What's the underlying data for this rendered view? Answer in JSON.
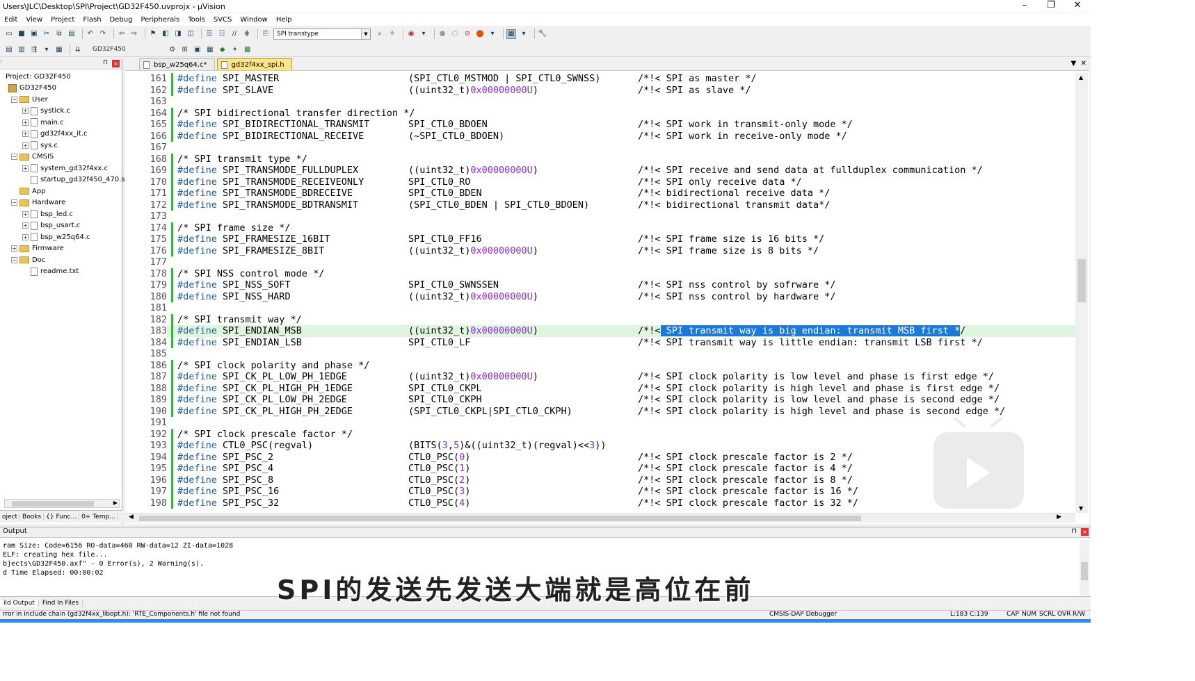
{
  "window": {
    "title": "Users\\JLC\\Desktop\\SPI\\Project\\GD32F450.uvprojx - µVision"
  },
  "menu": [
    "Edit",
    "View",
    "Project",
    "Flash",
    "Debug",
    "Peripherals",
    "Tools",
    "SVCS",
    "Window",
    "Help"
  ],
  "toolbar": {
    "find_combo": "SPI transtype",
    "target": "GD32F450"
  },
  "project": {
    "header": ":",
    "items": [
      {
        "label": "Project: GD32F450",
        "level": 0,
        "kind": "root"
      },
      {
        "label": "GD32F450",
        "level": 1,
        "kind": "project"
      },
      {
        "label": "User",
        "level": 2,
        "kind": "folder"
      },
      {
        "label": "systick.c",
        "level": 3,
        "kind": "file"
      },
      {
        "label": "main.c",
        "level": 3,
        "kind": "file"
      },
      {
        "label": "gd32f4xx_it.c",
        "level": 3,
        "kind": "file"
      },
      {
        "label": "sys.c",
        "level": 3,
        "kind": "file"
      },
      {
        "label": "CMSIS",
        "level": 2,
        "kind": "folder"
      },
      {
        "label": "system_gd32f4xx.c",
        "level": 3,
        "kind": "file"
      },
      {
        "label": "startup_gd32f450_470.s",
        "level": 3,
        "kind": "file"
      },
      {
        "label": "App",
        "level": 2,
        "kind": "folder"
      },
      {
        "label": "Hardware",
        "level": 2,
        "kind": "folder"
      },
      {
        "label": "bsp_led.c",
        "level": 3,
        "kind": "file"
      },
      {
        "label": "bsp_usart.c",
        "level": 3,
        "kind": "file"
      },
      {
        "label": "bsp_w25q64.c",
        "level": 3,
        "kind": "file"
      },
      {
        "label": "Firmware",
        "level": 2,
        "kind": "folder"
      },
      {
        "label": "Doc",
        "level": 2,
        "kind": "folder"
      },
      {
        "label": "readme.txt",
        "level": 3,
        "kind": "file"
      }
    ],
    "tabs": [
      "oject",
      "Books",
      "{} Func...",
      "0+ Temp..."
    ]
  },
  "editor": {
    "tabs": [
      {
        "label": "bsp_w25q64.c*",
        "active": false
      },
      {
        "label": "gd32f4xx_spi.h",
        "active": true
      }
    ],
    "current_line": 183,
    "lines": [
      {
        "n": "161",
        "a": "#define SPI_MASTER",
        "b": "(SPI_CTL0_MSTMOD | SPI_CTL0_SWNSS)",
        "c": "/*!< SPI as master */"
      },
      {
        "n": "162",
        "a": "#define SPI_SLAVE",
        "b": "((uint32_t)0x00000000U)",
        "c": "/*!< SPI as slave */"
      },
      {
        "n": "163",
        "a": "",
        "b": "",
        "c": ""
      },
      {
        "n": "164",
        "a": "/* SPI bidirectional transfer direction */",
        "b": "",
        "c": ""
      },
      {
        "n": "165",
        "a": "#define SPI_BIDIRECTIONAL_TRANSMIT",
        "b": "SPI_CTL0_BDOEN",
        "c": "/*!< SPI work in transmit-only mode */"
      },
      {
        "n": "166",
        "a": "#define SPI_BIDIRECTIONAL_RECEIVE",
        "b": "(~SPI_CTL0_BDOEN)",
        "c": "/*!< SPI work in receive-only mode */"
      },
      {
        "n": "167",
        "a": "",
        "b": "",
        "c": ""
      },
      {
        "n": "168",
        "a": "/* SPI transmit type */",
        "b": "",
        "c": ""
      },
      {
        "n": "169",
        "a": "#define SPI_TRANSMODE_FULLDUPLEX",
        "b": "((uint32_t)0x00000000U)",
        "c": "/*!< SPI receive and send data at fullduplex communication */"
      },
      {
        "n": "170",
        "a": "#define SPI_TRANSMODE_RECEIVEONLY",
        "b": "SPI_CTL0_RO",
        "c": "/*!< SPI only receive data */"
      },
      {
        "n": "171",
        "a": "#define SPI_TRANSMODE_BDRECEIVE",
        "b": "SPI_CTL0_BDEN",
        "c": "/*!< bidirectional receive data */"
      },
      {
        "n": "172",
        "a": "#define SPI_TRANSMODE_BDTRANSMIT",
        "b": "(SPI_CTL0_BDEN | SPI_CTL0_BDOEN)",
        "c": "/*!< bidirectional transmit data*/"
      },
      {
        "n": "173",
        "a": "",
        "b": "",
        "c": ""
      },
      {
        "n": "174",
        "a": "/* SPI frame size */",
        "b": "",
        "c": ""
      },
      {
        "n": "175",
        "a": "#define SPI_FRAMESIZE_16BIT",
        "b": "SPI_CTL0_FF16",
        "c": "/*!< SPI frame size is 16 bits */"
      },
      {
        "n": "176",
        "a": "#define SPI_FRAMESIZE_8BIT",
        "b": "((uint32_t)0x00000000U)",
        "c": "/*!< SPI frame size is 8 bits */"
      },
      {
        "n": "177",
        "a": "",
        "b": "",
        "c": ""
      },
      {
        "n": "178",
        "a": "/* SPI NSS control mode */",
        "b": "",
        "c": ""
      },
      {
        "n": "179",
        "a": "#define SPI_NSS_SOFT",
        "b": "SPI_CTL0_SWNSSEN",
        "c": "/*!< SPI nss control by sofrware */"
      },
      {
        "n": "180",
        "a": "#define SPI_NSS_HARD",
        "b": "((uint32_t)0x00000000U)",
        "c": "/*!< SPI nss control by hardware */"
      },
      {
        "n": "181",
        "a": "",
        "b": "",
        "c": ""
      },
      {
        "n": "182",
        "a": "/* SPI transmit way */",
        "b": "",
        "c": ""
      },
      {
        "n": "183",
        "a": "#define SPI_ENDIAN_MSB",
        "b": "((uint32_t)0x00000000U)",
        "c": "/*!< SPI transmit way is big endian: transmit MSB first */"
      },
      {
        "n": "184",
        "a": "#define SPI_ENDIAN_LSB",
        "b": "SPI_CTL0_LF",
        "c": "/*!< SPI transmit way is little endian: transmit LSB first */"
      },
      {
        "n": "185",
        "a": "",
        "b": "",
        "c": ""
      },
      {
        "n": "186",
        "a": "/* SPI clock polarity and phase */",
        "b": "",
        "c": ""
      },
      {
        "n": "187",
        "a": "#define SPI_CK_PL_LOW_PH_1EDGE",
        "b": "((uint32_t)0x00000000U)",
        "c": "/*!< SPI clock polarity is low level and phase is first edge */"
      },
      {
        "n": "188",
        "a": "#define SPI_CK_PL_HIGH_PH_1EDGE",
        "b": "SPI_CTL0_CKPL",
        "c": "/*!< SPI clock polarity is high level and phase is first edge */"
      },
      {
        "n": "189",
        "a": "#define SPI_CK_PL_LOW_PH_2EDGE",
        "b": "SPI_CTL0_CKPH",
        "c": "/*!< SPI clock polarity is low level and phase is second edge */"
      },
      {
        "n": "190",
        "a": "#define SPI_CK_PL_HIGH_PH_2EDGE",
        "b": "(SPI_CTL0_CKPL|SPI_CTL0_CKPH)",
        "c": "/*!< SPI clock polarity is high level and phase is second edge */"
      },
      {
        "n": "191",
        "a": "",
        "b": "",
        "c": ""
      },
      {
        "n": "192",
        "a": "/* SPI clock prescale factor */",
        "b": "",
        "c": ""
      },
      {
        "n": "193",
        "a": "#define CTL0_PSC(regval)",
        "b": "(BITS(3,5)&((uint32_t)(regval)<<3))",
        "c": ""
      },
      {
        "n": "194",
        "a": "#define SPI_PSC_2",
        "b": "CTL0_PSC(0)",
        "c": "/*!< SPI clock prescale factor is 2 */"
      },
      {
        "n": "195",
        "a": "#define SPI_PSC_4",
        "b": "CTL0_PSC(1)",
        "c": "/*!< SPI clock prescale factor is 4 */"
      },
      {
        "n": "196",
        "a": "#define SPI_PSC_8",
        "b": "CTL0_PSC(2)",
        "c": "/*!< SPI clock prescale factor is 8 */"
      },
      {
        "n": "197",
        "a": "#define SPI_PSC_16",
        "b": "CTL0_PSC(3)",
        "c": "/*!< SPI clock prescale factor is 16 */"
      },
      {
        "n": "198",
        "a": "#define SPI_PSC_32",
        "b": "CTL0_PSC(4)",
        "c": "/*!< SPI clock prescale factor is 32 */"
      }
    ]
  },
  "output": {
    "title": "Output",
    "lines": [
      "ram Size: Code=6156 RO-data=460 RW-data=12 ZI-data=1028",
      "ELF: creating hex file...",
      "bjects\\GD32F450.axf\" - 0 Error(s), 2 Warning(s).",
      "d Time Elapsed:  00:00:02"
    ],
    "tabs": [
      "ild Output",
      "Find In Files"
    ]
  },
  "status": {
    "message": "rror in include chain (gd32f4xx_libopt.h): 'RTE_Components.h' file not found",
    "debugger": "CMSIS-DAP Debugger",
    "position": "L:183 C:139",
    "cap": "CAP",
    "num": "NUM",
    "scrl": "SCRL",
    "ovr": "OVR",
    "rw": "R/W"
  },
  "subtitle": "SPI的发送先发送大端就是高位在前",
  "colors": {
    "comment": "#1a5fa8",
    "number": "#8a2be2",
    "selection": "#1e78d7",
    "current_line": "#dff5df",
    "active_tab": "#ffe58a"
  }
}
